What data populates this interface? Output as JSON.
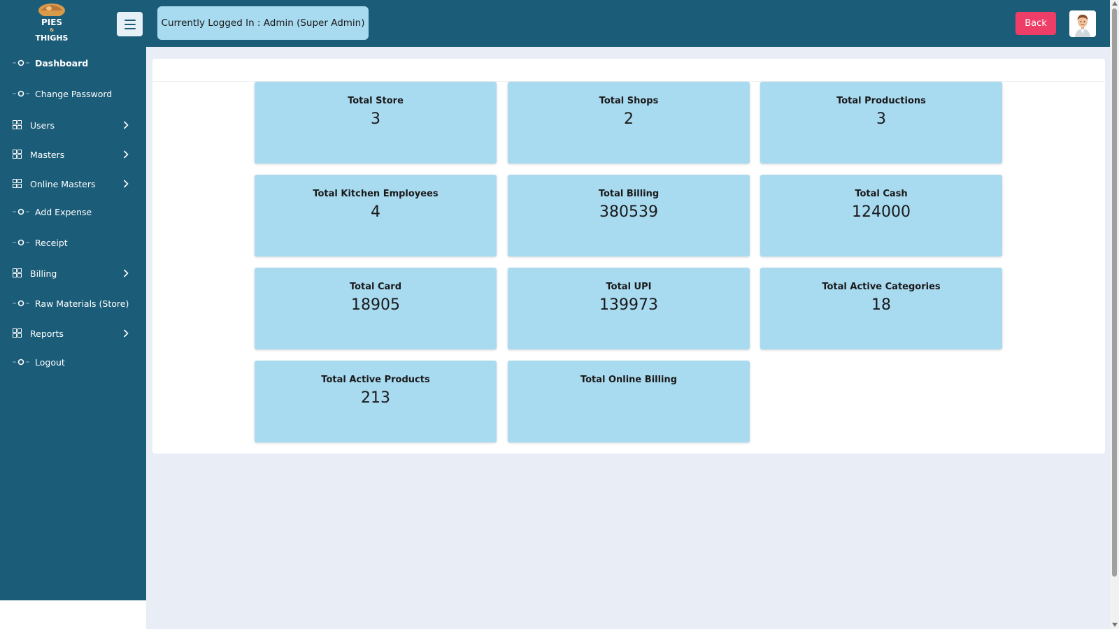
{
  "header": {
    "logo_text_top": "PIES",
    "logo_text_mid": "&",
    "logo_text_bottom": "THIGHS",
    "logged_in_text": "Currently Logged In : Admin (Super Admin)",
    "back_label": "Back"
  },
  "sidebar": {
    "items": [
      {
        "label": "Dashboard",
        "icon": "dot-circle-icon"
      },
      {
        "label": "Change Password",
        "icon": "dot-circle-icon"
      },
      {
        "label": "Users",
        "icon": "grid-icon",
        "has_children": true
      },
      {
        "label": "Masters",
        "icon": "grid-icon",
        "has_children": true
      },
      {
        "label": "Online Masters",
        "icon": "grid-icon",
        "has_children": true
      },
      {
        "label": "Add Expense",
        "icon": "dot-circle-icon"
      },
      {
        "label": "Receipt",
        "icon": "dot-circle-icon"
      },
      {
        "label": "Billing",
        "icon": "grid-icon",
        "has_children": true
      },
      {
        "label": "Raw Materials (Store)",
        "icon": "dot-circle-icon"
      },
      {
        "label": "Reports",
        "icon": "grid-icon",
        "has_children": true
      },
      {
        "label": "Logout",
        "icon": "dot-circle-icon"
      }
    ]
  },
  "dashboard": {
    "tiles": [
      {
        "title": "Total Store",
        "value": "3"
      },
      {
        "title": "Total Shops",
        "value": "2"
      },
      {
        "title": "Total Productions",
        "value": "3"
      },
      {
        "title": "Total Kitchen Employees",
        "value": "4"
      },
      {
        "title": "Total Billing",
        "value": "380539"
      },
      {
        "title": "Total Cash",
        "value": "124000"
      },
      {
        "title": "Total Card",
        "value": "18905"
      },
      {
        "title": "Total UPI",
        "value": "139973"
      },
      {
        "title": "Total Active Categories",
        "value": "18"
      },
      {
        "title": "Total Active Products",
        "value": "213"
      },
      {
        "title": "Total Online Billing",
        "value": ""
      }
    ]
  },
  "colors": {
    "header_bg": "#1b5c78",
    "tile_bg": "#a8daf0",
    "back_button": "#ee3d67",
    "page_bg": "#e9edf5"
  }
}
